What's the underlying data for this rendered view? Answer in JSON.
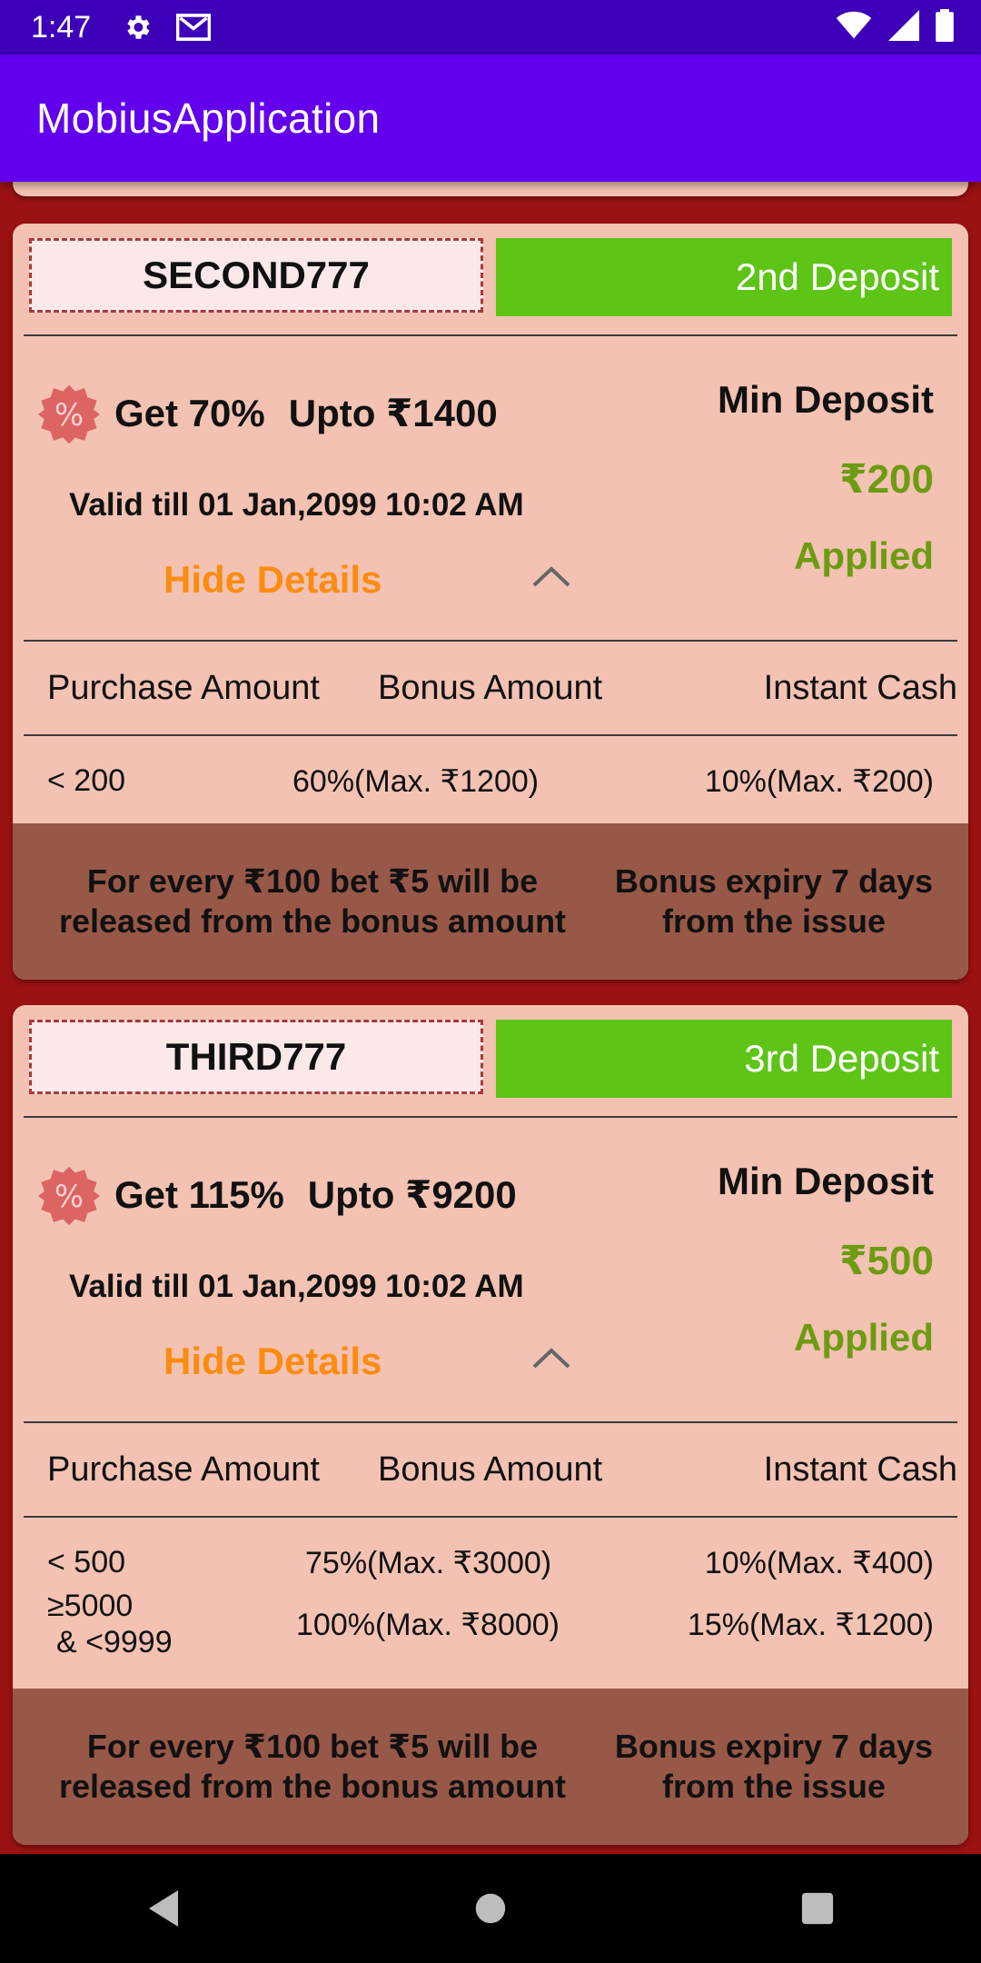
{
  "status_bar": {
    "time": "1:47",
    "icons_left": [
      "gear-icon",
      "gmail-icon"
    ],
    "icons_right": [
      "wifi-icon",
      "signal-icon",
      "battery-icon"
    ]
  },
  "app_bar": {
    "title": "MobiusApplication"
  },
  "colors": {
    "status_bar": "#3d00b8",
    "app_bar": "#6200ee",
    "page_background": "#9b1212",
    "card_background": "#f3c2b2",
    "deposit_label": "#5ec416",
    "hide_details": "#fb8c12",
    "applied_green": "#6d9b12",
    "footer_background": "#985848"
  },
  "cards": [
    {
      "code": "SECOND777",
      "deposit_label": "2nd Deposit",
      "offer_percent": "Get 70%",
      "offer_upto": "Upto ₹1400",
      "valid_till": "Valid till 01 Jan,2099 10:02 AM",
      "hide_details": "Hide Details",
      "min_deposit_label": "Min Deposit",
      "min_deposit_amount": "₹200",
      "status": "Applied",
      "table_headers": [
        "Purchase Amount",
        "Bonus Amount",
        "Instant Cash"
      ],
      "rows": [
        {
          "purchase": "< 200",
          "bonus": "60%(Max. ₹1200)",
          "instant": "10%(Max. ₹200)"
        }
      ],
      "footer_left": "For every ₹100 bet ₹5 will be released from the bonus amount",
      "footer_right": "Bonus expiry 7 days from the issue"
    },
    {
      "code": "THIRD777",
      "deposit_label": "3rd Deposit",
      "offer_percent": "Get 115%",
      "offer_upto": "Upto ₹9200",
      "valid_till": "Valid till 01 Jan,2099 10:02 AM",
      "hide_details": "Hide Details",
      "min_deposit_label": "Min Deposit",
      "min_deposit_amount": "₹500",
      "status": "Applied",
      "table_headers": [
        "Purchase Amount",
        "Bonus Amount",
        "Instant Cash"
      ],
      "rows": [
        {
          "purchase": "< 500",
          "bonus": "75%(Max. ₹3000)",
          "instant": "10%(Max. ₹400)"
        },
        {
          "purchase_line1": "≥5000",
          "purchase_line2": "& <9999",
          "bonus": "100%(Max. ₹8000)",
          "instant": "15%(Max. ₹1200)"
        }
      ],
      "footer_left": "For every ₹100 bet ₹5 will be released from the bonus amount",
      "footer_right": "Bonus expiry 7 days from the issue"
    }
  ],
  "nav_bar": {
    "buttons": [
      "back-icon",
      "home-icon",
      "recents-icon"
    ]
  }
}
